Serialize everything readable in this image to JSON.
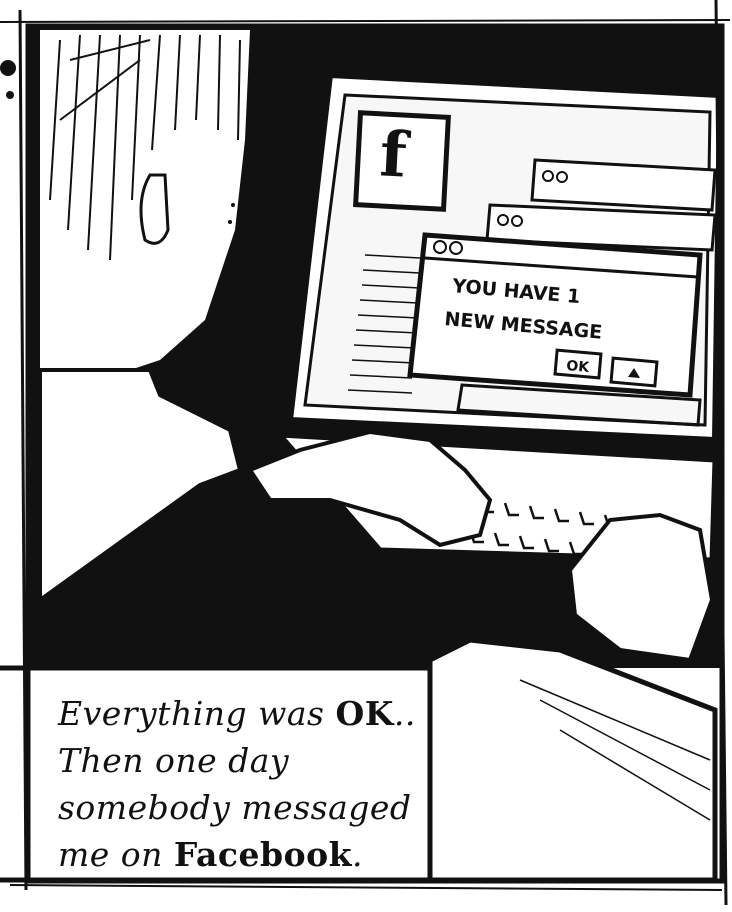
{
  "popup": {
    "line1": "YOU HAVE 1",
    "line2": "NEW MESSAGE",
    "ok_label": "OK",
    "second_button_icon": "arrow-up-icon"
  },
  "logo": {
    "letter": "f",
    "icon": "facebook-logo-icon"
  },
  "caption": {
    "line1_prefix": "Everything was ",
    "line1_ok": "OK",
    "line1_suffix": "..",
    "line2": "Then one day",
    "line3": "somebody messaged",
    "line4_prefix": "me on ",
    "line4_brand": "Facebook",
    "line4_suffix": "."
  },
  "colors": {
    "ink": "#111111",
    "paper": "#ffffff",
    "screen": "#f7f7f7"
  }
}
